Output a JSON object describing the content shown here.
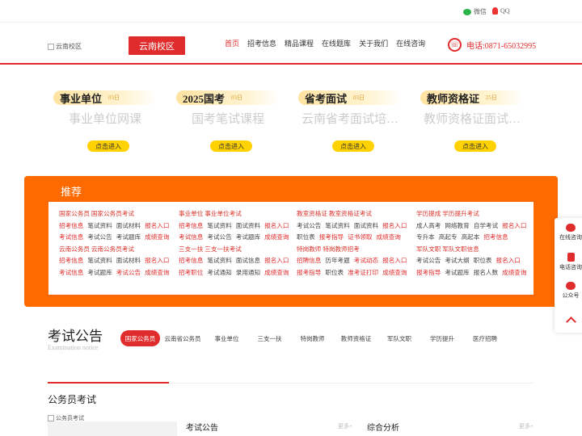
{
  "topbar": {
    "wechat_label": "微信",
    "qq_label": "QQ"
  },
  "header": {
    "logo_alt": "云南校区",
    "campus_button": "云南校区",
    "nav": [
      "首页",
      "招考信息",
      "精品课程",
      "在线题库",
      "关于我们",
      "在线咨询"
    ],
    "phone": "电话:0871-65032995"
  },
  "cards": [
    {
      "tag": "事业单位",
      "date": "03日",
      "subtitle": "事业单位网课",
      "button": "点击进入"
    },
    {
      "tag": "2025国考",
      "date": "03日",
      "subtitle": "国考笔试课程",
      "button": "点击进入"
    },
    {
      "tag": "省考面试",
      "date": "03日",
      "subtitle": "云南省考面试培…",
      "button": "点击进入"
    },
    {
      "tag": "教师资格证",
      "date": "25日",
      "subtitle": "教师资格证面试…",
      "button": "点击进入"
    }
  ],
  "recommend": {
    "title": "推荐",
    "columns": [
      {
        "groups": [
          {
            "head": "国家公务员 国家公务员考试",
            "rows": [
              [
                "招考信息",
                "笔试资料",
                "面试材料",
                "报名入口"
              ],
              [
                "考试信息",
                "考试公告",
                "考试题库",
                "成绩查询"
              ]
            ]
          },
          {
            "head": "云南公务员 云南公务员考试",
            "rows": [
              [
                "招考信息",
                "笔试资料",
                "面试材料",
                "报名入口"
              ],
              [
                "考试信息",
                "考试题库",
                "考试公告",
                "成绩查询"
              ]
            ]
          }
        ]
      },
      {
        "groups": [
          {
            "head": "事业单位 事业单位考试",
            "rows": [
              [
                "招考信息",
                "笔试资料",
                "面试资料",
                "报名入口"
              ],
              [
                "考试信息",
                "考试公告",
                "考试题库",
                "成绩查询"
              ]
            ]
          },
          {
            "head": "三支一扶 三支一扶考试",
            "rows": [
              [
                "招考信息",
                "笔试资料",
                "面试信息",
                "报名入口"
              ],
              [
                "招考职位",
                "考试通知",
                "录用通知",
                "成绩查询"
              ]
            ]
          }
        ]
      },
      {
        "groups": [
          {
            "head": "教室资格证 教室资格证考试",
            "rows": [
              [
                "考试公告",
                "笔试资料",
                "面试资料",
                "报名入口"
              ],
              [
                "职位表",
                "报考指导",
                "证书领取",
                "成绩查询"
              ]
            ]
          },
          {
            "head": "特岗教师 特岗教师招考",
            "rows": [
              [
                "招聘信息",
                "历年考题",
                "考试动态",
                "报名入口"
              ],
              [
                "报考指导",
                "职位表",
                "准考证打印",
                "成绩查询"
              ]
            ]
          }
        ]
      },
      {
        "groups": [
          {
            "head": "学历提成 学历提升考试",
            "rows": [
              [
                "成人高考",
                "网络教育",
                "自学考试",
                "报名入口"
              ],
              [
                "专升本",
                "高起专",
                "高起本",
                "招考信息"
              ]
            ]
          },
          {
            "head": "军队文职 军队文职信息",
            "rows": [
              [
                "考试公告",
                "考试大纲",
                "职位表",
                "报名入口"
              ],
              [
                "报考指导",
                "考试题库",
                "报名人数",
                "成绩查询"
              ]
            ]
          }
        ]
      }
    ]
  },
  "side": {
    "items": [
      "在线咨询",
      "电话咨询",
      "公众号"
    ]
  },
  "notice": {
    "title": "考试公告",
    "subtitle": "Examination notice",
    "tabs": [
      "国家公务员",
      "云南省公务员",
      "事业单位",
      "三支一扶",
      "特岗教师",
      "教师资格证",
      "军队文职",
      "学历提升",
      "医疗招聘"
    ]
  },
  "section": {
    "title": "公务员考试",
    "image_alt": "公务员考试",
    "col1": "考试公告",
    "col2": "综合分析",
    "more": "更多+"
  }
}
